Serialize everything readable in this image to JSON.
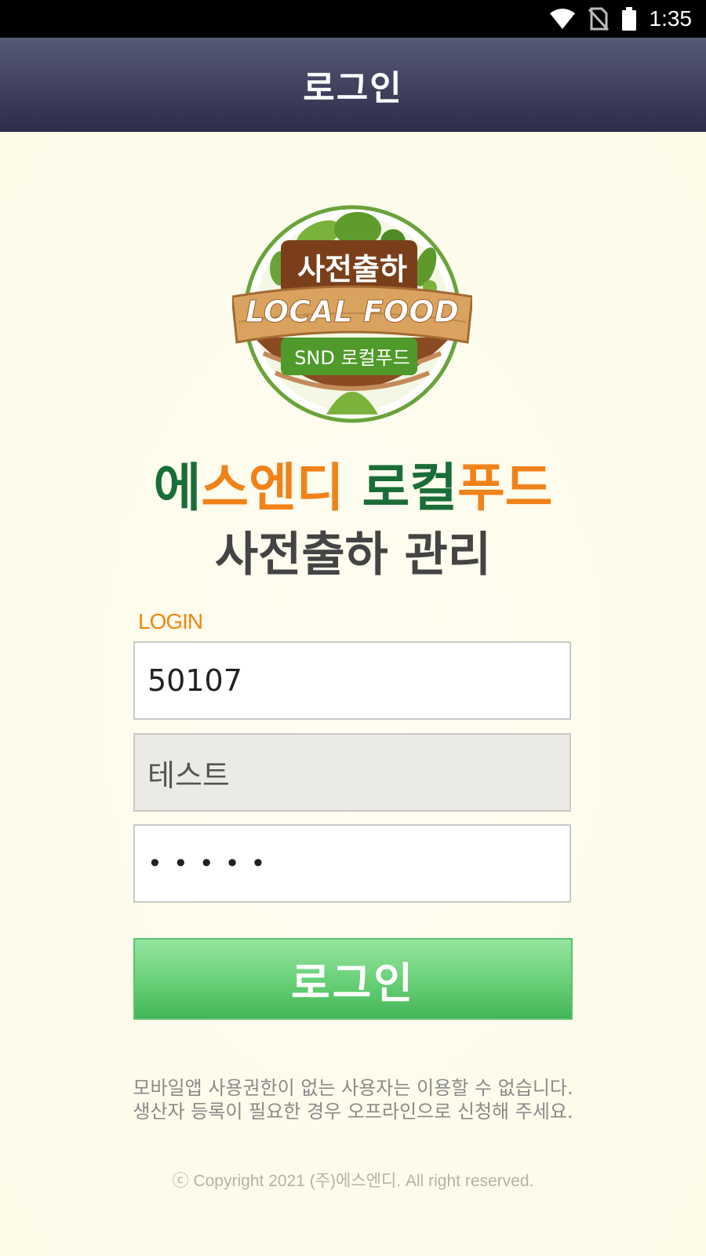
{
  "status_bar": {
    "time": "1:35",
    "icons": [
      "wifi-icon",
      "no-sim-icon",
      "battery-icon"
    ]
  },
  "header": {
    "title": "로그인"
  },
  "logo": {
    "top_text": "사전출하",
    "banner_text": "LOCAL FOOD",
    "bottom_text": "SND 로컬푸드"
  },
  "brand": {
    "line1": [
      "에",
      "스엔디",
      " 로컬",
      "푸드"
    ],
    "line2": "사전출하 관리"
  },
  "login_form": {
    "section_label": "LOGIN",
    "id_value": "50107",
    "name_value": "테스트",
    "password_value": "•••••",
    "submit_label": "로그인"
  },
  "notice": {
    "line1": "모바일앱 사용권한이 없는 사용자는 이용할 수 없습니다.",
    "line2": "생산자 등록이 필요한 경우 오프라인으로 신청해 주세요."
  },
  "footer": {
    "copyright": "ⓒ Copyright 2021 (주)에스엔디. All right reserved."
  },
  "colors": {
    "brand_green": "#1a6d38",
    "brand_orange": "#f08219",
    "button_green": "#67cf76",
    "header_bg": "#3d3a5a"
  }
}
